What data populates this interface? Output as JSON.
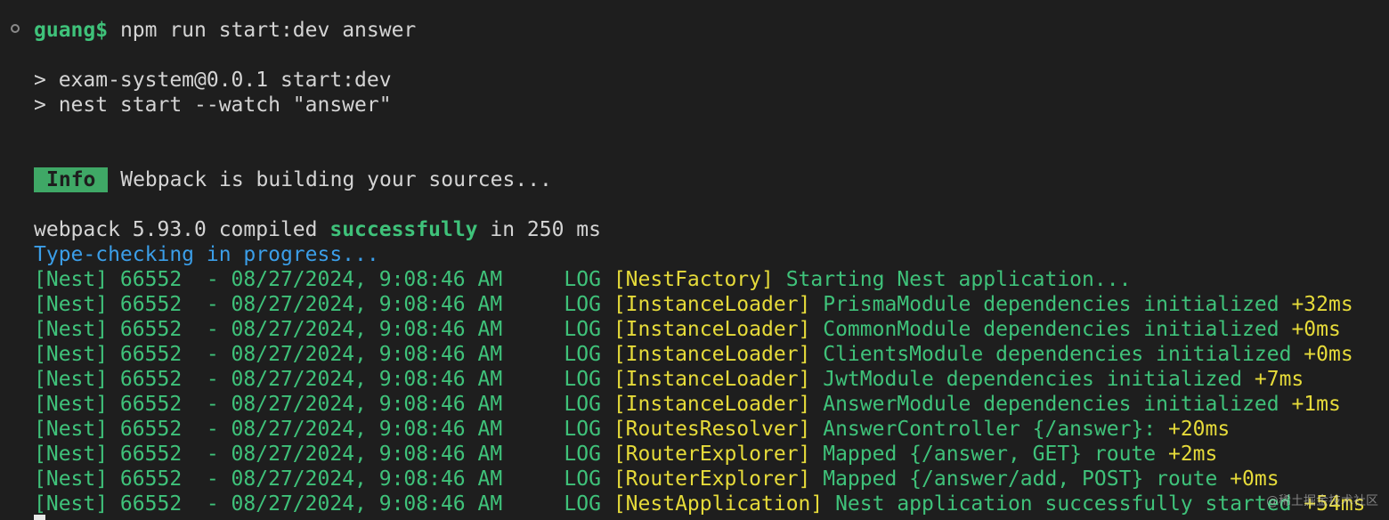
{
  "prompt": {
    "user": "guang$",
    "command": " npm run start:dev answer"
  },
  "npm_lines": [
    "> exam-system@0.0.1 start:dev",
    "> nest start --watch \"answer\""
  ],
  "info": {
    "badge": "Info",
    "text": " Webpack is building your sources..."
  },
  "webpack": {
    "prefix": "webpack 5.93.0 compiled ",
    "status": "successfully",
    "suffix": " in 250 ms"
  },
  "type_check": "Type-checking in progress...",
  "logs": [
    {
      "prefix": "[Nest] 66552  - 08/27/2024, 9:08:46 AM     LOG ",
      "context": "[NestFactory]",
      "message": " Starting Nest application...",
      "timing": ""
    },
    {
      "prefix": "[Nest] 66552  - 08/27/2024, 9:08:46 AM     LOG ",
      "context": "[InstanceLoader]",
      "message": " PrismaModule dependencies initialized ",
      "timing": "+32ms"
    },
    {
      "prefix": "[Nest] 66552  - 08/27/2024, 9:08:46 AM     LOG ",
      "context": "[InstanceLoader]",
      "message": " CommonModule dependencies initialized ",
      "timing": "+0ms"
    },
    {
      "prefix": "[Nest] 66552  - 08/27/2024, 9:08:46 AM     LOG ",
      "context": "[InstanceLoader]",
      "message": " ClientsModule dependencies initialized ",
      "timing": "+0ms"
    },
    {
      "prefix": "[Nest] 66552  - 08/27/2024, 9:08:46 AM     LOG ",
      "context": "[InstanceLoader]",
      "message": " JwtModule dependencies initialized ",
      "timing": "+7ms"
    },
    {
      "prefix": "[Nest] 66552  - 08/27/2024, 9:08:46 AM     LOG ",
      "context": "[InstanceLoader]",
      "message": " AnswerModule dependencies initialized ",
      "timing": "+1ms"
    },
    {
      "prefix": "[Nest] 66552  - 08/27/2024, 9:08:46 AM     LOG ",
      "context": "[RoutesResolver]",
      "message": " AnswerController {/answer}: ",
      "timing": "+20ms"
    },
    {
      "prefix": "[Nest] 66552  - 08/27/2024, 9:08:46 AM     LOG ",
      "context": "[RouterExplorer]",
      "message": " Mapped {/answer, GET} route ",
      "timing": "+2ms"
    },
    {
      "prefix": "[Nest] 66552  - 08/27/2024, 9:08:46 AM     LOG ",
      "context": "[RouterExplorer]",
      "message": " Mapped {/answer/add, POST} route ",
      "timing": "+0ms"
    },
    {
      "prefix": "[Nest] 66552  - 08/27/2024, 9:08:46 AM     LOG ",
      "context": "[NestApplication]",
      "message": " Nest application successfully started ",
      "timing": "+54ms"
    }
  ],
  "watermark": "@稀土掘金技术社区"
}
